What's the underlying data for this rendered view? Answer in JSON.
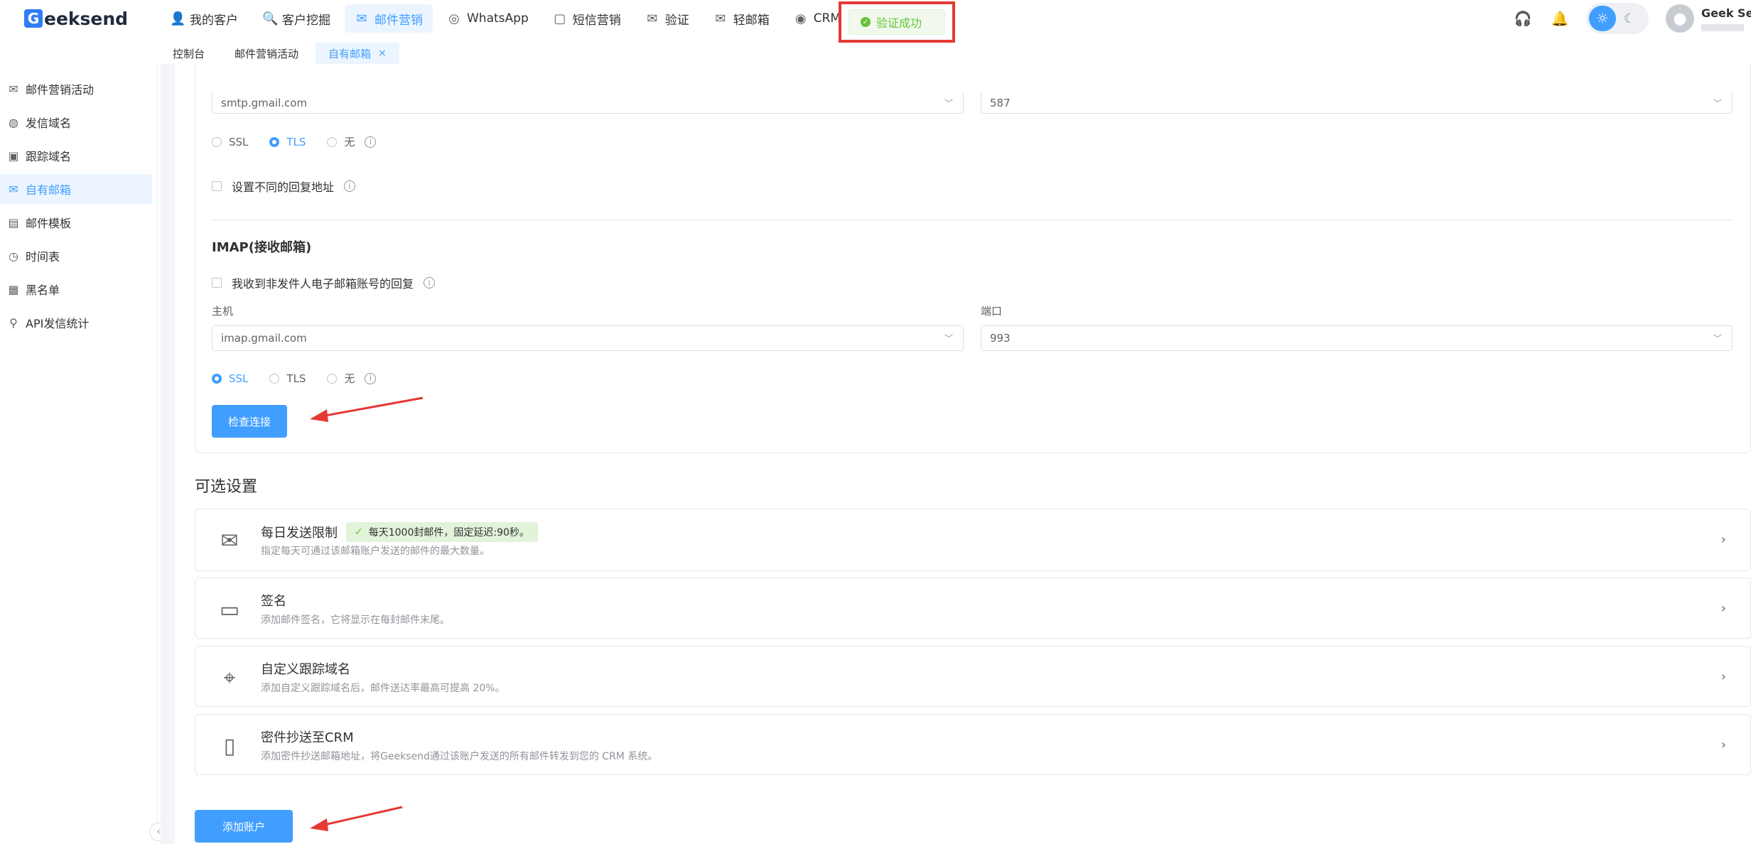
{
  "brand": {
    "logo_letter": "G",
    "logo_rest": "eeksend"
  },
  "topnav": [
    {
      "icon": "👤",
      "label": "我的客户"
    },
    {
      "icon": "🔍",
      "label": "客户挖掘"
    },
    {
      "icon": "✉",
      "label": "邮件营销"
    },
    {
      "icon": "◎",
      "label": "WhatsApp"
    },
    {
      "icon": "▢",
      "label": "短信营销"
    },
    {
      "icon": "✉",
      "label": "验证"
    },
    {
      "icon": "✉",
      "label": "轻邮箱"
    },
    {
      "icon": "◉",
      "label": "CRM"
    }
  ],
  "toast": {
    "text": "验证成功"
  },
  "user": {
    "name": "Geek Sen"
  },
  "tabs": [
    {
      "label": "控制台"
    },
    {
      "label": "邮件营销活动"
    },
    {
      "label": "自有邮箱",
      "close": "×"
    }
  ],
  "sidebar": [
    {
      "icon": "✉",
      "label": "邮件营销活动"
    },
    {
      "icon": "◍",
      "label": "发信域名"
    },
    {
      "icon": "▣",
      "label": "跟踪域名"
    },
    {
      "icon": "✉",
      "label": "自有邮箱"
    },
    {
      "icon": "▤",
      "label": "邮件模板"
    },
    {
      "icon": "◷",
      "label": "时间表"
    },
    {
      "icon": "▦",
      "label": "黑名单"
    },
    {
      "icon": "⚲",
      "label": "API发信统计"
    }
  ],
  "smtp": {
    "host": "smtp.gmail.com",
    "port": "587",
    "enc_options": [
      "SSL",
      "TLS",
      "无"
    ],
    "enc_selected": "TLS",
    "reply_checkbox": "设置不同的回复地址"
  },
  "imap": {
    "title": "IMAP(接收邮箱)",
    "checkbox": "我收到非发件人电子邮箱账号的回复",
    "host_label": "主机",
    "host": "imap.gmail.com",
    "port_label": "端口",
    "port": "993",
    "enc_options": [
      "SSL",
      "TLS",
      "无"
    ],
    "enc_selected": "SSL",
    "check_button": "检查连接"
  },
  "optional": {
    "title": "可选设置",
    "cards": [
      {
        "icon": "✉",
        "title": "每日发送限制",
        "tag": "每天1000封邮件，固定延迟:90秒。",
        "desc": "指定每天可通过该邮箱账户发送的邮件的最大数量。"
      },
      {
        "icon": "▭",
        "title": "签名",
        "desc": "添加邮件签名，它将显示在每封邮件末尾。"
      },
      {
        "icon": "⌖",
        "title": "自定义跟踪域名",
        "desc": "添加自定义跟踪域名后，邮件送达率最高可提高 20%。"
      },
      {
        "icon": "▯",
        "title": "密件抄送至CRM",
        "desc": "添加密件抄送邮箱地址，将Geeksend通过该账户发送的所有邮件转发到您的 CRM 系统。"
      }
    ]
  },
  "add_button": "添加账户",
  "colors": {
    "primary": "#409eff",
    "success": "#67c23a",
    "highlight": "#e53935"
  }
}
